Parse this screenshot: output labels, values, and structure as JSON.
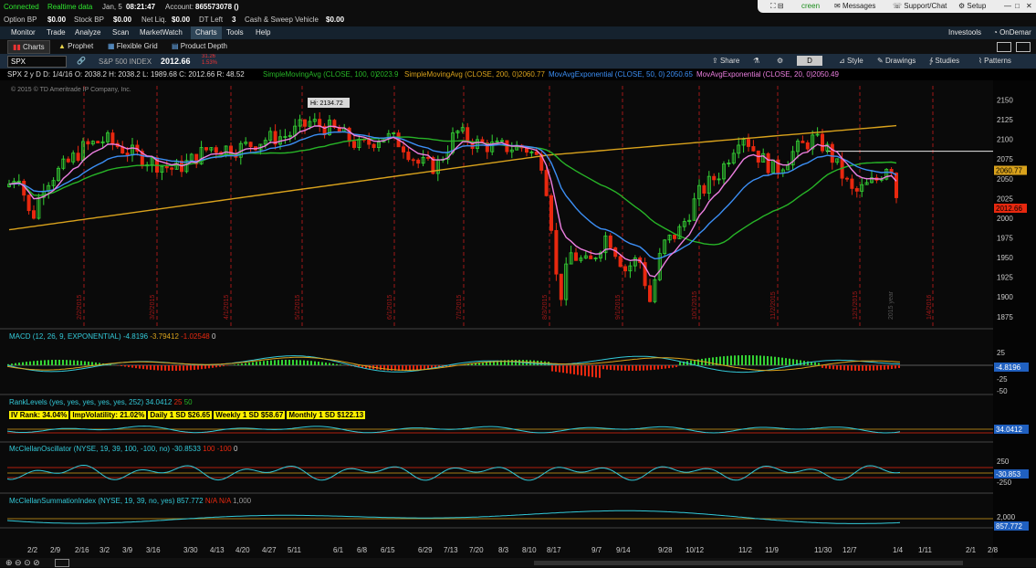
{
  "status": {
    "connected": "Connected",
    "realtime": "Realtime data",
    "date": "Jan, 5",
    "time": "08:21:47",
    "account_label": "Account:",
    "account": "865573078 ()"
  },
  "account_bar": {
    "option_bp_label": "Option BP",
    "option_bp": "$0.00",
    "stock_bp_label": "Stock BP",
    "stock_bp": "$0.00",
    "net_liq_label": "Net Liq.",
    "net_liq": "$0.00",
    "dt_left_label": "DT Left",
    "dt_left": "3",
    "cash_label": "Cash & Sweep Vehicle",
    "cash": "$0.00"
  },
  "topright": {
    "screen": "creen",
    "messages": "Messages",
    "support": "Support/Chat",
    "setup": "Setup"
  },
  "menu": [
    "Monitor",
    "Trade",
    "Analyze",
    "Scan",
    "MarketWatch",
    "Charts",
    "Tools",
    "Help"
  ],
  "menu_right": {
    "investools": "Investools",
    "ondemand": "OnDemar"
  },
  "subtabs": [
    "Charts",
    "Prophet",
    "Flexible Grid",
    "Product Depth"
  ],
  "chart_header": {
    "symbol": "SPX",
    "name": "S&P 500 INDEX",
    "price": "2012.66",
    "chg1": "31.26",
    "chg2": "1.53%",
    "share": "Share",
    "period": "D",
    "style": "Style",
    "drawings": "Drawings",
    "studies": "Studies",
    "patterns": "Patterns"
  },
  "studies_line": {
    "ohlc": "SPX 2 y D  D: 1/4/16  O: 2038.2  H: 2038.2  L: 1989.68  C: 2012.66  R: 48.52",
    "sma100": "SimpleMovingAvg (CLOSE, 100, 0)",
    "sma100_val": "2023.9",
    "sma200": "SimpleMovingAvg (CLOSE, 200, 0)",
    "sma200_val": "2060.77",
    "ema50": "MovAvgExponential (CLOSE, 50, 0)",
    "ema50_val": "2050.65",
    "ema20": "MovAvgExponential (CLOSE, 20, 0)",
    "ema20_val": "2050.49"
  },
  "copyright": "© 2015 © TD Ameritrade IP Company, Inc.",
  "hi_label": "Hi: 2134.72",
  "colors": {
    "up": "#34d234",
    "down": "#e8280f",
    "sma100": "#27b427",
    "sma200": "#d9a21c",
    "ema50": "#3c8ff5",
    "ema20": "#ec7fe0",
    "cyan": "#33c9d8"
  },
  "chart_data": {
    "type": "candlestick",
    "symbol": "SPX",
    "y_ticks": [
      1875,
      1900,
      1925,
      1950,
      1975,
      2000,
      2025,
      2050,
      2075,
      2100,
      2125,
      2150
    ],
    "ylim": [
      1862,
      2168
    ],
    "x_ticks": [
      "2/2",
      "2/9",
      "2/16",
      "3/2",
      "3/9",
      "3/16",
      "3/30",
      "4/13",
      "4/20",
      "4/27",
      "5/11",
      "6/1",
      "6/8",
      "6/15",
      "6/29",
      "7/13",
      "7/20",
      "8/3",
      "8/10",
      "8/17",
      "9/7",
      "9/14",
      "9/28",
      "10/12",
      "11/2",
      "11/9",
      "11/30",
      "12/7",
      "1/4",
      "1/11",
      "2/1",
      "2/8"
    ],
    "month_labels": [
      "2/2/2015",
      "3/2/2015",
      "4/1/2015",
      "5/1/2015",
      "6/1/2015",
      "7/1/2015",
      "8/3/2015",
      "9/1/2015",
      "10/1/2015",
      "11/2/2015",
      "12/1/2015",
      "2015 year",
      "1/4/2016"
    ],
    "price_tags": [
      {
        "label": "2060.77",
        "color": "#d9a21c"
      },
      {
        "label": "2012.66",
        "color": "#e8280f"
      }
    ],
    "horizontal_line": 2085,
    "macd": {
      "label": "MACD (12, 26, 9, EXPONENTIAL)",
      "value": "-4.8196",
      "signal": "-3.79412",
      "diff": "-1.02548",
      "zero": "0",
      "ticks": [
        "25",
        "-25",
        "-50"
      ],
      "tag": "-4.8196"
    },
    "rank": {
      "label": "RankLevels (yes, yes, yes, yes, yes, 252)",
      "value": "34.0412",
      "lo": "25",
      "hi": "50",
      "tag": "34.0412"
    },
    "rank_boxes": [
      "IV Rank: 34.04%",
      "ImpVolatility: 21.02%",
      "Daily 1 SD  $26.65",
      "Weekly 1 SD  $58.67",
      "Monthly 1 SD  $122.13"
    ],
    "mcclellan": {
      "label": "McClellanOscillator (NYSE, 19, 39, 100, -100, no)",
      "value": "-30.8533",
      "p": "100",
      "n": "-100",
      "z": "0",
      "ticks": [
        "250",
        "-250"
      ],
      "tag": "-30.853"
    },
    "summation": {
      "label": "McClellanSummationIndex (NYSE, 19, 39, no, yes)",
      "value": "857.772",
      "na1": "N/A",
      "na2": "N/A",
      "extra": "1,000",
      "ticks": [
        "2,000"
      ],
      "tag": "857.772"
    }
  }
}
